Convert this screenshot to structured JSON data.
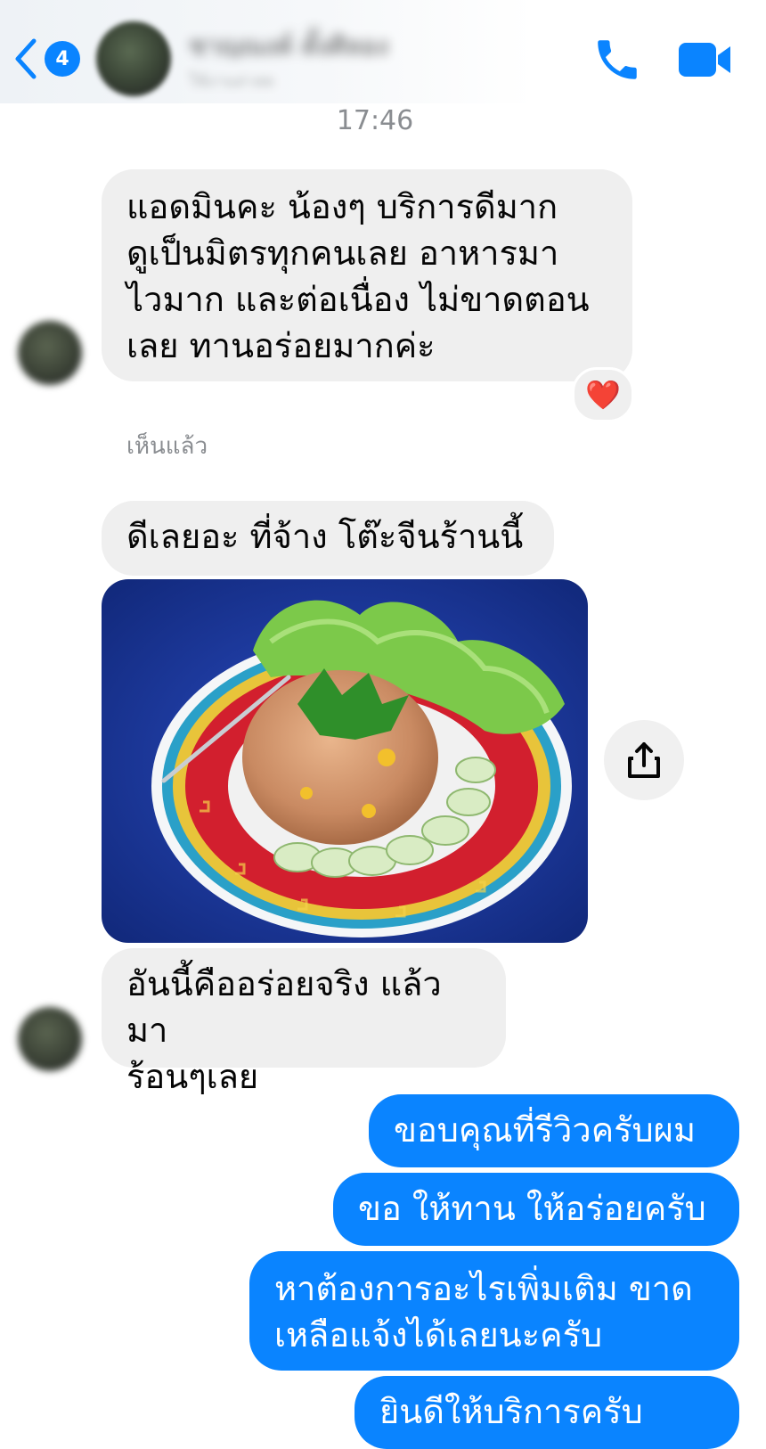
{
  "header": {
    "back_badge": "4",
    "contact_name": "ชาญณงค์ ตั้งศิลอง",
    "contact_status": "ใช้งานล่าสุด"
  },
  "timestamp": "17:46",
  "seen_label": "เห็นแล้ว",
  "reaction_emoji": "❤️",
  "messages": [
    {
      "id": "m1",
      "direction": "incoming",
      "lines": [
        "แอดมินคะ น้องๆ บริการดีมาก",
        "ดูเป็นมิตรทุกคนเลย อาหารมา",
        "ไวมาก และต่อเนื่อง ไม่ขาดตอน",
        "เลย ทานอร่อยมากค่ะ"
      ]
    },
    {
      "id": "m2",
      "direction": "incoming",
      "lines": [
        "ดีเลยอะ ที่จ้าง โต๊ะจีนร้านนี้"
      ]
    },
    {
      "id": "m3",
      "direction": "incoming",
      "type": "photo"
    },
    {
      "id": "m4",
      "direction": "incoming",
      "lines": [
        "อันนี้คืออร่อยจริง แล้วมา",
        "ร้อนๆเลย"
      ]
    },
    {
      "id": "m5",
      "direction": "outgoing",
      "lines": [
        "ขอบคุณที่รีวิวครับผม"
      ]
    },
    {
      "id": "m6",
      "direction": "outgoing",
      "lines": [
        "ขอ ให้ทาน ให้อร่อยครับ"
      ]
    },
    {
      "id": "m7",
      "direction": "outgoing",
      "lines": [
        "หาต้องการอะไรเพิ่มเติม ขาด",
        "เหลือแจ้งได้เลยนะครับ"
      ]
    },
    {
      "id": "m8",
      "direction": "outgoing",
      "lines": [
        "ยินดีให้บริการครับ"
      ]
    }
  ],
  "colors": {
    "accent": "#0a84ff",
    "incoming_bubble": "#efefef",
    "plate_red": "#d21f2e",
    "tablecloth_blue": "#1a3aa8"
  }
}
